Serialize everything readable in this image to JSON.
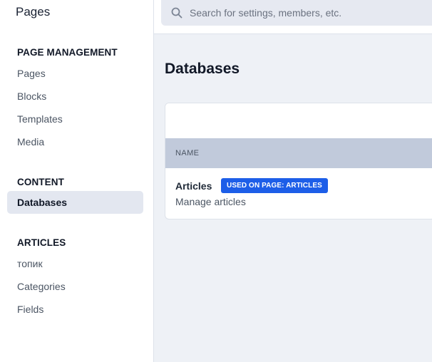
{
  "sidebar": {
    "title": "Pages",
    "sections": [
      {
        "heading": "PAGE MANAGEMENT",
        "items": [
          "Pages",
          "Blocks",
          "Templates",
          "Media"
        ]
      },
      {
        "heading": "CONTENT",
        "items": [
          "Databases"
        ]
      },
      {
        "heading": "ARTICLES",
        "items": [
          "топик",
          "Categories",
          "Fields"
        ]
      }
    ],
    "active_item": "Databases"
  },
  "search": {
    "placeholder": "Search for settings, members, etc."
  },
  "main": {
    "title": "Databases",
    "table": {
      "columns": [
        "NAME"
      ],
      "rows": [
        {
          "name": "Articles",
          "badge": "USED ON PAGE: ARTICLES",
          "description": "Manage articles"
        }
      ]
    }
  },
  "colors": {
    "accent": "#1d5ee8",
    "active_nav_bg": "#e3e7f0",
    "table_header_bg": "#c1cadb",
    "page_bg": "#eef1f6"
  }
}
